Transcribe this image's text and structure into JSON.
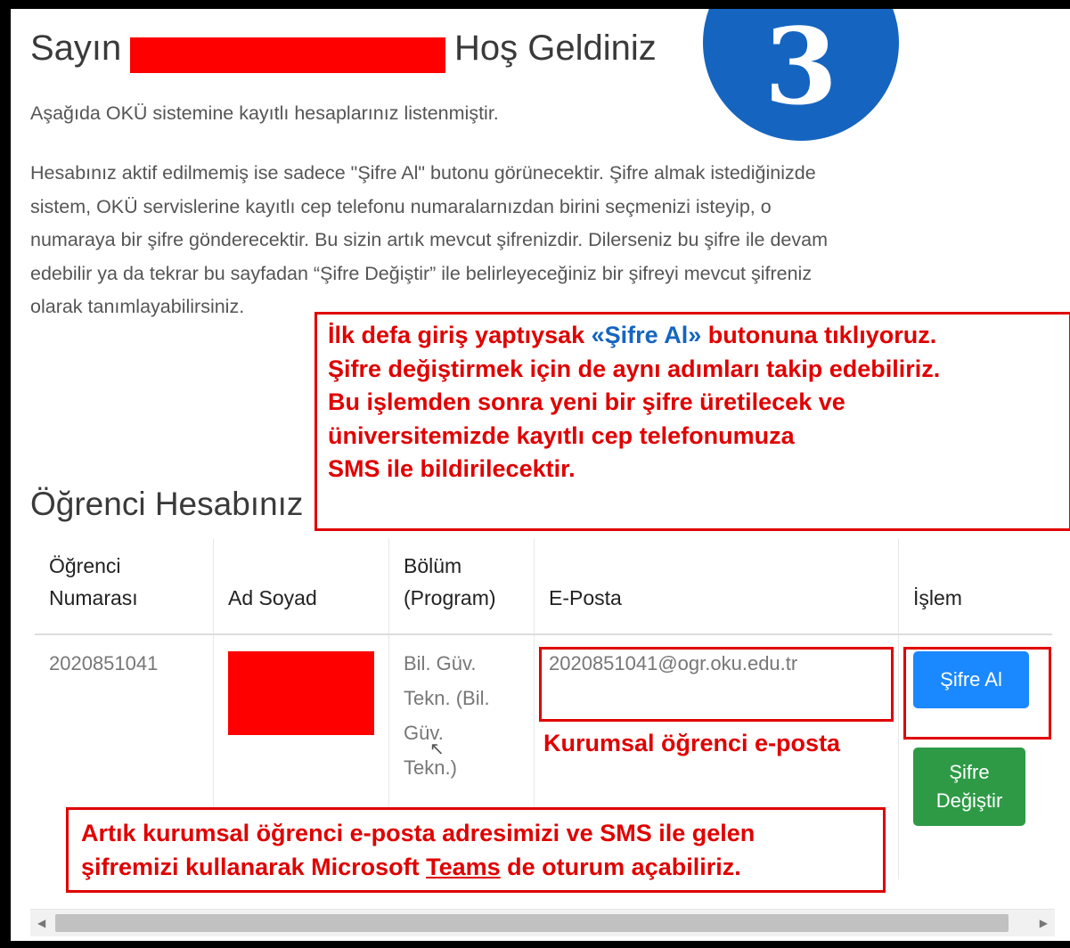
{
  "colors": {
    "accent_red": "#e00000",
    "badge_blue": "#1565c0",
    "button_blue": "#1a88ff",
    "button_green": "#2e9a46"
  },
  "header": {
    "greeting_prefix": "Sayın",
    "greeting_suffix": "Hoş Geldiniz"
  },
  "badge": {
    "number": "3"
  },
  "intro": "Aşağıda OKÜ sistemine kayıtlı hesaplarınız listenmiştir.",
  "paragraph": [
    "Hesabınız aktif edilmemiş ise sadece \"Şifre Al\" butonu görünecektir. Şifre almak istediğinizde",
    "sistem, OKÜ servislerine kayıtlı cep telefonu numaralarnızdan birini seçmenizi isteyip, o",
    "numaraya bir şifre gönderecektir. Bu sizin artık mevcut şifrenizdir. Dilerseniz bu şifre ile devam",
    "edebilir ya da tekrar bu sayfadan “Şifre Değiştir” ile belirleyeceğiniz bir şifreyi mevcut şifreniz",
    "olarak tanımlayabilirsiniz."
  ],
  "note_top": {
    "line1_a": "İlk defa giriş yaptıysak ",
    "line1_b": "«Şifre Al»",
    "line1_c": " butonuna tıklıyoruz.",
    "line2": "Şifre değiştirmek için de aynı adımları takip edebiliriz.",
    "line3": "Bu işlemden sonra yeni bir şifre üretilecek ve",
    "line4": "üniversitemizde kayıtlı cep telefonumuza",
    "line5": "SMS ile bildirilecektir."
  },
  "section_title": "Öğrenci Hesabınız",
  "table": {
    "headers": {
      "student_no_1": "Öğrenci",
      "student_no_2": "Numarası",
      "name": "Ad Soyad",
      "dept_1": "Bölüm",
      "dept_2": "(Program)",
      "email": "E-Posta",
      "action": "İşlem"
    },
    "row": {
      "student_no": "2020851041",
      "dept_lines": [
        "Bil. Güv.",
        "Tekn. (Bil.",
        "Güv.",
        "Tekn.)"
      ],
      "email": "2020851041@ogr.oku.edu.tr"
    }
  },
  "buttons": {
    "get_password": "Şifre Al",
    "change_1": "Şifre",
    "change_2": "Değiştir"
  },
  "email_caption": "Kurumsal öğrenci e-posta",
  "note_bottom": {
    "line1": "Artık kurumsal öğrenci e-posta adresimizi ve SMS ile gelen",
    "line2_a": "şifremizi kullanarak Microsoft ",
    "line2_b": "Teams",
    "line2_c": " de oturum açabiliriz."
  }
}
